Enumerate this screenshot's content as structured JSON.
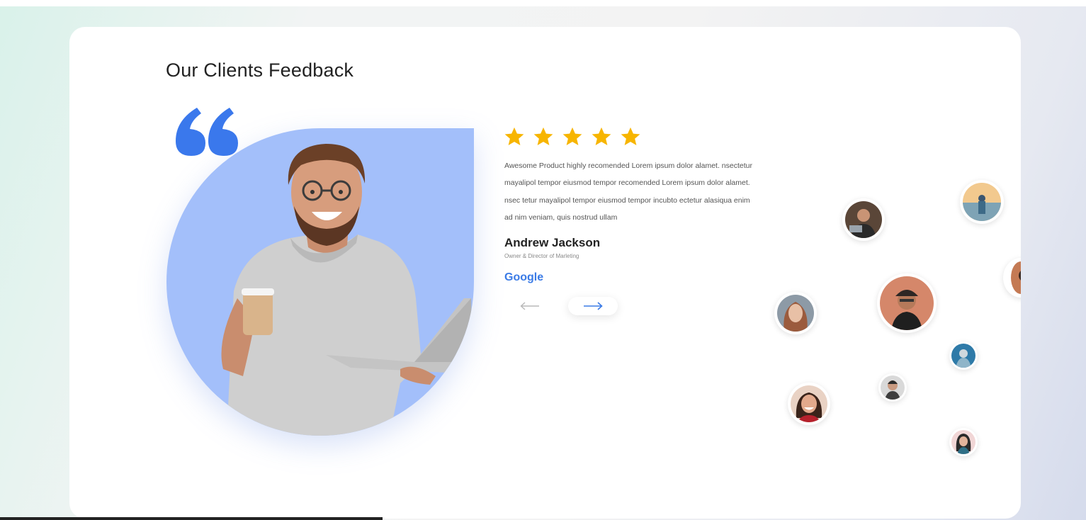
{
  "section": {
    "title": "Our Clients Feedback"
  },
  "testimonial": {
    "rating": 5,
    "rating_max": 5,
    "text": "Awesome Product highly recomended Lorem ipsum dolor alamet. nsectetur mayalipol tempor eiusmod tempor recomended Lorem ipsum dolor alamet. nsec tetur mayalipol tempor eiusmod tempor incubto ectetur alasiqua enim ad nim veniam, quis nostrud ullam",
    "author_name": "Andrew Jackson",
    "author_role": "Owner & Director of Marleting",
    "company": "Google"
  },
  "navigation": {
    "prev_icon": "arrow-left-icon",
    "next_icon": "arrow-right-icon"
  },
  "colors": {
    "accent": "#3b7be6",
    "blob": "#a3bffa",
    "star": "#f7b500",
    "quote": "#3a78ec"
  },
  "avatars": [
    {
      "name": "client-avatar-1"
    },
    {
      "name": "client-avatar-2"
    },
    {
      "name": "client-avatar-3"
    },
    {
      "name": "client-avatar-4"
    },
    {
      "name": "client-avatar-5"
    },
    {
      "name": "client-avatar-6"
    },
    {
      "name": "client-avatar-7"
    },
    {
      "name": "client-avatar-8"
    },
    {
      "name": "client-avatar-9"
    }
  ]
}
